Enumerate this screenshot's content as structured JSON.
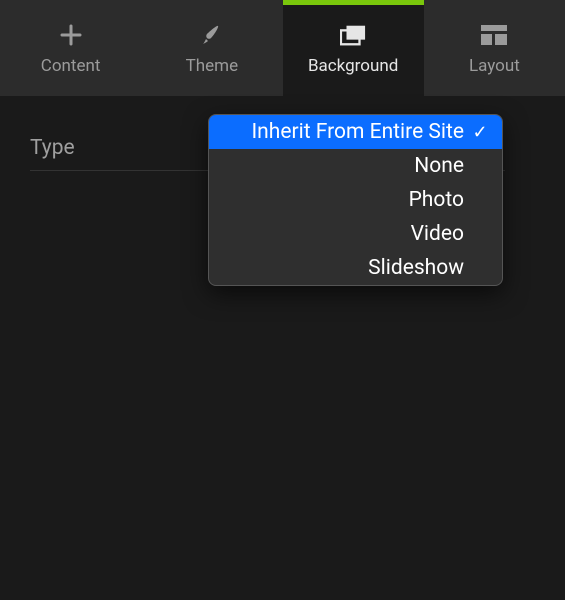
{
  "tabs": [
    {
      "id": "content",
      "label": "Content",
      "icon": "plus-icon",
      "active": false
    },
    {
      "id": "theme",
      "label": "Theme",
      "icon": "brush-icon",
      "active": false
    },
    {
      "id": "background",
      "label": "Background",
      "icon": "background-icon",
      "active": true
    },
    {
      "id": "layout",
      "label": "Layout",
      "icon": "layout-icon",
      "active": false
    }
  ],
  "field": {
    "label": "Type"
  },
  "dropdown": {
    "options": [
      {
        "label": "Inherit From Entire Site",
        "selected": true
      },
      {
        "label": "None",
        "selected": false
      },
      {
        "label": "Photo",
        "selected": false
      },
      {
        "label": "Video",
        "selected": false
      },
      {
        "label": "Slideshow",
        "selected": false
      }
    ],
    "checkmark": "✓"
  },
  "colors": {
    "accent": "#7ac70c",
    "selection": "#0b6dff"
  }
}
